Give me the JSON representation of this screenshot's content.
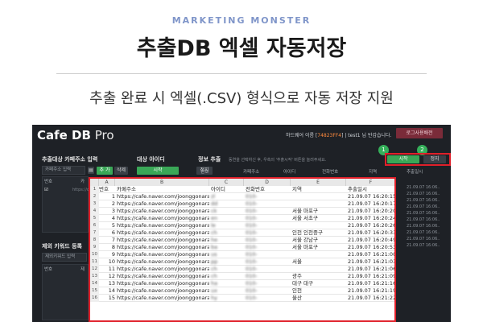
{
  "banner": {
    "brand": "MARKETING MONSTER",
    "headline": "추출DB 엑셀 자동저장",
    "subtitle": "추출 완료 시 엑셀(.CSV) 형식으로 자동 저장 지원"
  },
  "app": {
    "logo_main": "Cafe DB",
    "logo_suffix": "Pro",
    "hw_label": "하드웨어 이름 [",
    "hw_id": "74823FF4",
    "hw_rest": "] | test1 님 반갑습니다.",
    "logout": "로그사용배전",
    "cafe_section": "추출대상 카페주소 입력",
    "cafe_input_placeholder": "카페주소 입력",
    "cafe_add": "추 가",
    "cafe_delete": "삭제",
    "cafe_list_headers": [
      "번호",
      "카"
    ],
    "cafe_list_row": "https://ca...",
    "target_section": "대상 아이디",
    "target_start": "시작",
    "target_stop": "정지",
    "info_section": "정보 추출",
    "info_note": "동연을 선택하신 후, 우측의 '추출시작' 버튼을 눌러주세요.",
    "info_headers": [
      "번호",
      "카페주소",
      "아이디",
      "전화번호",
      "지역",
      "추출일시"
    ],
    "info_start": "시작",
    "info_stop": "정지",
    "badge1": "1",
    "badge2": "2",
    "exclude_section": "제외 키워드 등록",
    "exclude_input": "제외키워드 입력",
    "exclude_headers": [
      "번호",
      "제"
    ],
    "mini_dates": [
      "21.09.07 16:06..",
      "21.09.07 16:06..",
      "21.09.07 16:06..",
      "21.09.07 16:06..",
      "21.09.07 16:06..",
      "21.09.07 16:06..",
      "21.09.07 16:06..",
      "21.09.07 16:06..",
      "21.09.07 16:06..",
      "21.09.07 16:06.."
    ]
  },
  "sheet": {
    "col_letters": [
      "A",
      "B",
      "C",
      "D",
      "E",
      "F"
    ],
    "headers": [
      "번호",
      "카페주소",
      "아이디",
      "전화번호",
      "지역",
      "추출일시"
    ],
    "rows": [
      {
        "n": "1",
        "url": "https://cafe.naver.com/joonggonara",
        "id": "zl",
        "phone": "010-",
        "region": "",
        "date": "21.09.07 16:20:15"
      },
      {
        "n": "2",
        "url": "https://cafe.naver.com/joonggonara",
        "id": "dd",
        "phone": "010-",
        "region": "",
        "date": "21.09.07 16:20:17"
      },
      {
        "n": "3",
        "url": "https://cafe.naver.com/joonggonara",
        "id": "ck",
        "phone": "010-",
        "region": "서울 마포구",
        "date": "21.09.07 16:20:20"
      },
      {
        "n": "4",
        "url": "https://cafe.naver.com/joonggonara",
        "id": "en",
        "phone": "010-",
        "region": "서울 서초구",
        "date": "21.09.07 16:20:24"
      },
      {
        "n": "5",
        "url": "https://cafe.naver.com/joonggonara",
        "id": "le",
        "phone": "010-",
        "region": "",
        "date": "21.09.07 16:20:26"
      },
      {
        "n": "6",
        "url": "https://cafe.naver.com/joonggonara",
        "id": "ch",
        "phone": "010-",
        "region": "인천 인천중구",
        "date": "21.09.07 16:20:33"
      },
      {
        "n": "7",
        "url": "https://cafe.naver.com/joonggonara",
        "id": "he",
        "phone": "010-",
        "region": "서울 강남구",
        "date": "21.09.07 16:20:49"
      },
      {
        "n": "8",
        "url": "https://cafe.naver.com/joonggonara",
        "id": "ba",
        "phone": "010-",
        "region": "서울 마포구",
        "date": "21.09.07 16:20:53"
      },
      {
        "n": "9",
        "url": "https://cafe.naver.com/joonggonara",
        "id": "us",
        "phone": "010-",
        "region": "",
        "date": "21.09.07 16:21:00"
      },
      {
        "n": "10",
        "url": "https://cafe.naver.com/joonggonara",
        "id": "pp",
        "phone": "010-",
        "region": "서울",
        "date": "21.09.07 16:21:03"
      },
      {
        "n": "11",
        "url": "https://cafe.naver.com/joonggonara",
        "id": "ch",
        "phone": "010-",
        "region": "",
        "date": "21.09.07 16:21:06"
      },
      {
        "n": "12",
        "url": "https://cafe.naver.com/joonggonara",
        "id": "ch",
        "phone": "010-",
        "region": "광주",
        "date": "21.09.07 16:21:09"
      },
      {
        "n": "13",
        "url": "https://cafe.naver.com/joonggonara",
        "id": "ha",
        "phone": "010-",
        "region": "대구 대구",
        "date": "21.09.07 16:21:16"
      },
      {
        "n": "14",
        "url": "https://cafe.naver.com/joonggonara",
        "id": "ux",
        "phone": "010-",
        "region": "인천",
        "date": "21.09.07 16:21:19"
      },
      {
        "n": "15",
        "url": "https://cafe.naver.com/joonggonara",
        "id": "hy",
        "phone": "010-",
        "region": "울산",
        "date": "21.09.07 16:21:22"
      }
    ]
  }
}
